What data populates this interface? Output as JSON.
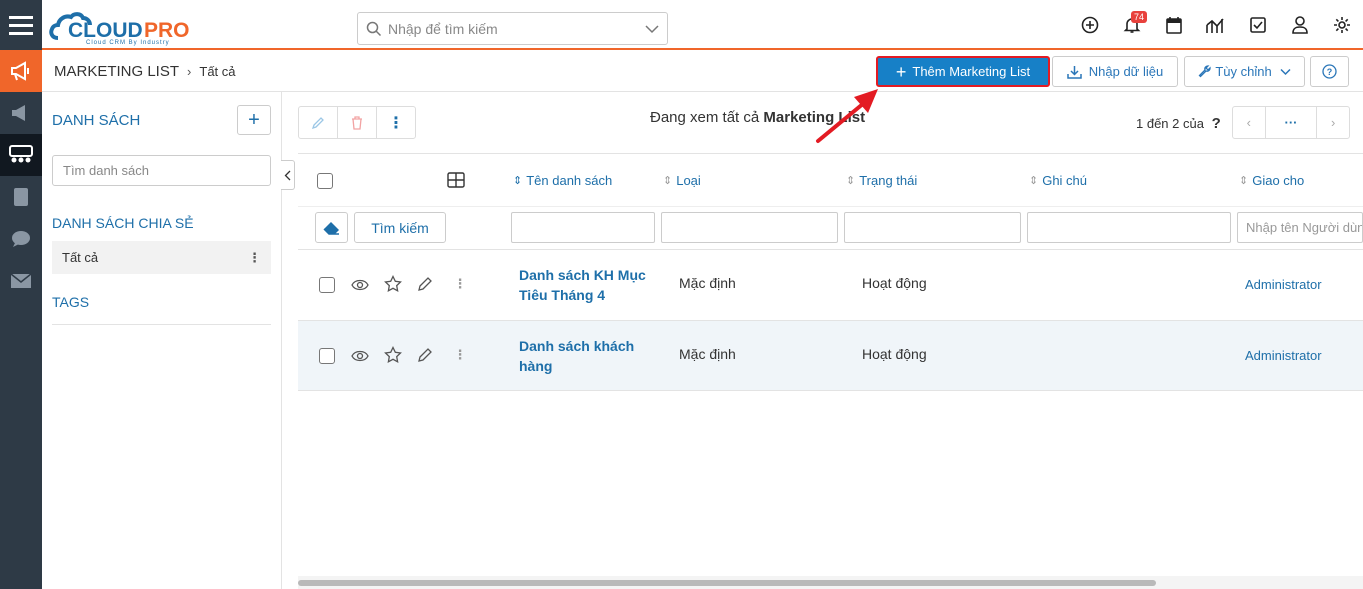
{
  "header": {
    "logo_text": "CLOUDPRO",
    "logo_tagline": "Cloud CRM By Industry",
    "search_placeholder": "Nhập để tìm kiếm",
    "notification_count": "74"
  },
  "breadcrumb": {
    "module": "MARKETING LIST",
    "current": "Tất cả"
  },
  "actions": {
    "add_label": "Thêm Marketing List",
    "import_label": "Nhập dữ liệu",
    "customize_label": "Tùy chỉnh"
  },
  "sidebar": {
    "lists_title": "DANH SÁCH",
    "search_placeholder": "Tìm danh sách",
    "shared_title": "DANH SÁCH CHIA SẺ",
    "shared_item": "Tất cả",
    "tags_title": "TAGS"
  },
  "listview": {
    "viewing_prefix": "Đang xem tất cả",
    "viewing_module": "Marketing List",
    "pager_text": "1 đến 2 của",
    "pager_unknown": "?",
    "columns": [
      "Tên danh sách",
      "Loại",
      "Trạng thái",
      "Ghi chú",
      "Giao cho"
    ],
    "search_button": "Tìm kiếm",
    "assignee_filter_placeholder": "Nhập tên Người dùng",
    "rows": [
      {
        "name": "Danh sách KH Mục Tiêu Tháng 4",
        "type": "Mặc định",
        "status": "Hoạt động",
        "note": "",
        "assignee": "Administrator"
      },
      {
        "name": "Danh sách khách hàng",
        "type": "Mặc định",
        "status": "Hoạt động",
        "note": "",
        "assignee": "Administrator"
      }
    ]
  },
  "colors": {
    "accent": "#f0662a",
    "primary": "#1780c7",
    "link": "#1e6fa9",
    "rail": "#2e3a46"
  }
}
